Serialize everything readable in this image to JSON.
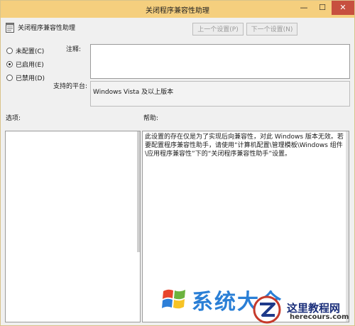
{
  "window": {
    "title": "关闭程序兼容性助理",
    "controls": {
      "minimize": "—",
      "maximize": "☐",
      "close": "✕"
    }
  },
  "header": {
    "setting_name": "关闭程序兼容性助理",
    "prev_button": "上一个设置(P)",
    "next_button": "下一个设置(N)"
  },
  "state": {
    "options": [
      {
        "label": "未配置(C)",
        "selected": false
      },
      {
        "label": "已启用(E)",
        "selected": true
      },
      {
        "label": "已禁用(D)",
        "selected": false
      }
    ]
  },
  "comment": {
    "label": "注释:",
    "value": ""
  },
  "platform": {
    "label": "支持的平台:",
    "value": "Windows Vista 及以上版本"
  },
  "sections": {
    "options_label": "选项:",
    "help_label": "帮助:"
  },
  "help": {
    "text": "此设置的存在仅是为了实现后向兼容性，对此 Windows 版本无效。若要配置程序兼容性助手，请使用“计算机配置\\管理模板\\Windows 组件\\应用程序兼容性”下的“关闭程序兼容性助手”设置。"
  },
  "watermark": {
    "brand": "系统大全",
    "site_name": "这里教程网",
    "site_url": "herecours.com"
  },
  "colors": {
    "titlebar": "#f5cf7e",
    "close": "#c7503f",
    "accent": "#2a7fd6"
  }
}
